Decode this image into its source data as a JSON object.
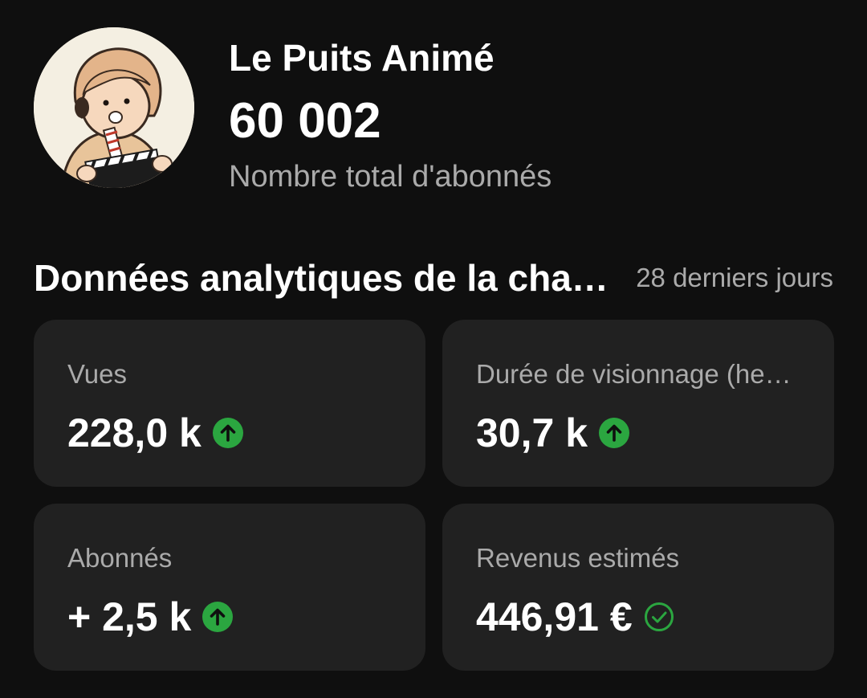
{
  "channel": {
    "name": "Le Puits Animé",
    "subscribers": "60 002",
    "subscribers_label": "Nombre total d'abonnés",
    "avatar_icon": "cartoon-child-clapperboard-avatar"
  },
  "analytics": {
    "title": "Données analytiques de la chaîne",
    "period": "28 derniers jours",
    "cards": [
      {
        "label": "Vues",
        "value": "228,0 k",
        "status_icon": "arrow-up-circle-icon"
      },
      {
        "label": "Durée de visionnage (heures)",
        "value": "30,7 k",
        "status_icon": "arrow-up-circle-icon"
      },
      {
        "label": "Abonnés",
        "value": "+ 2,5 k",
        "status_icon": "arrow-up-circle-icon"
      },
      {
        "label": "Revenus estimés",
        "value": "446,91 €",
        "status_icon": "check-circle-icon"
      }
    ]
  },
  "colors": {
    "background": "#0f0f0f",
    "card": "#212121",
    "secondary_text": "#aaaaaa",
    "positive": "#2ba640"
  }
}
